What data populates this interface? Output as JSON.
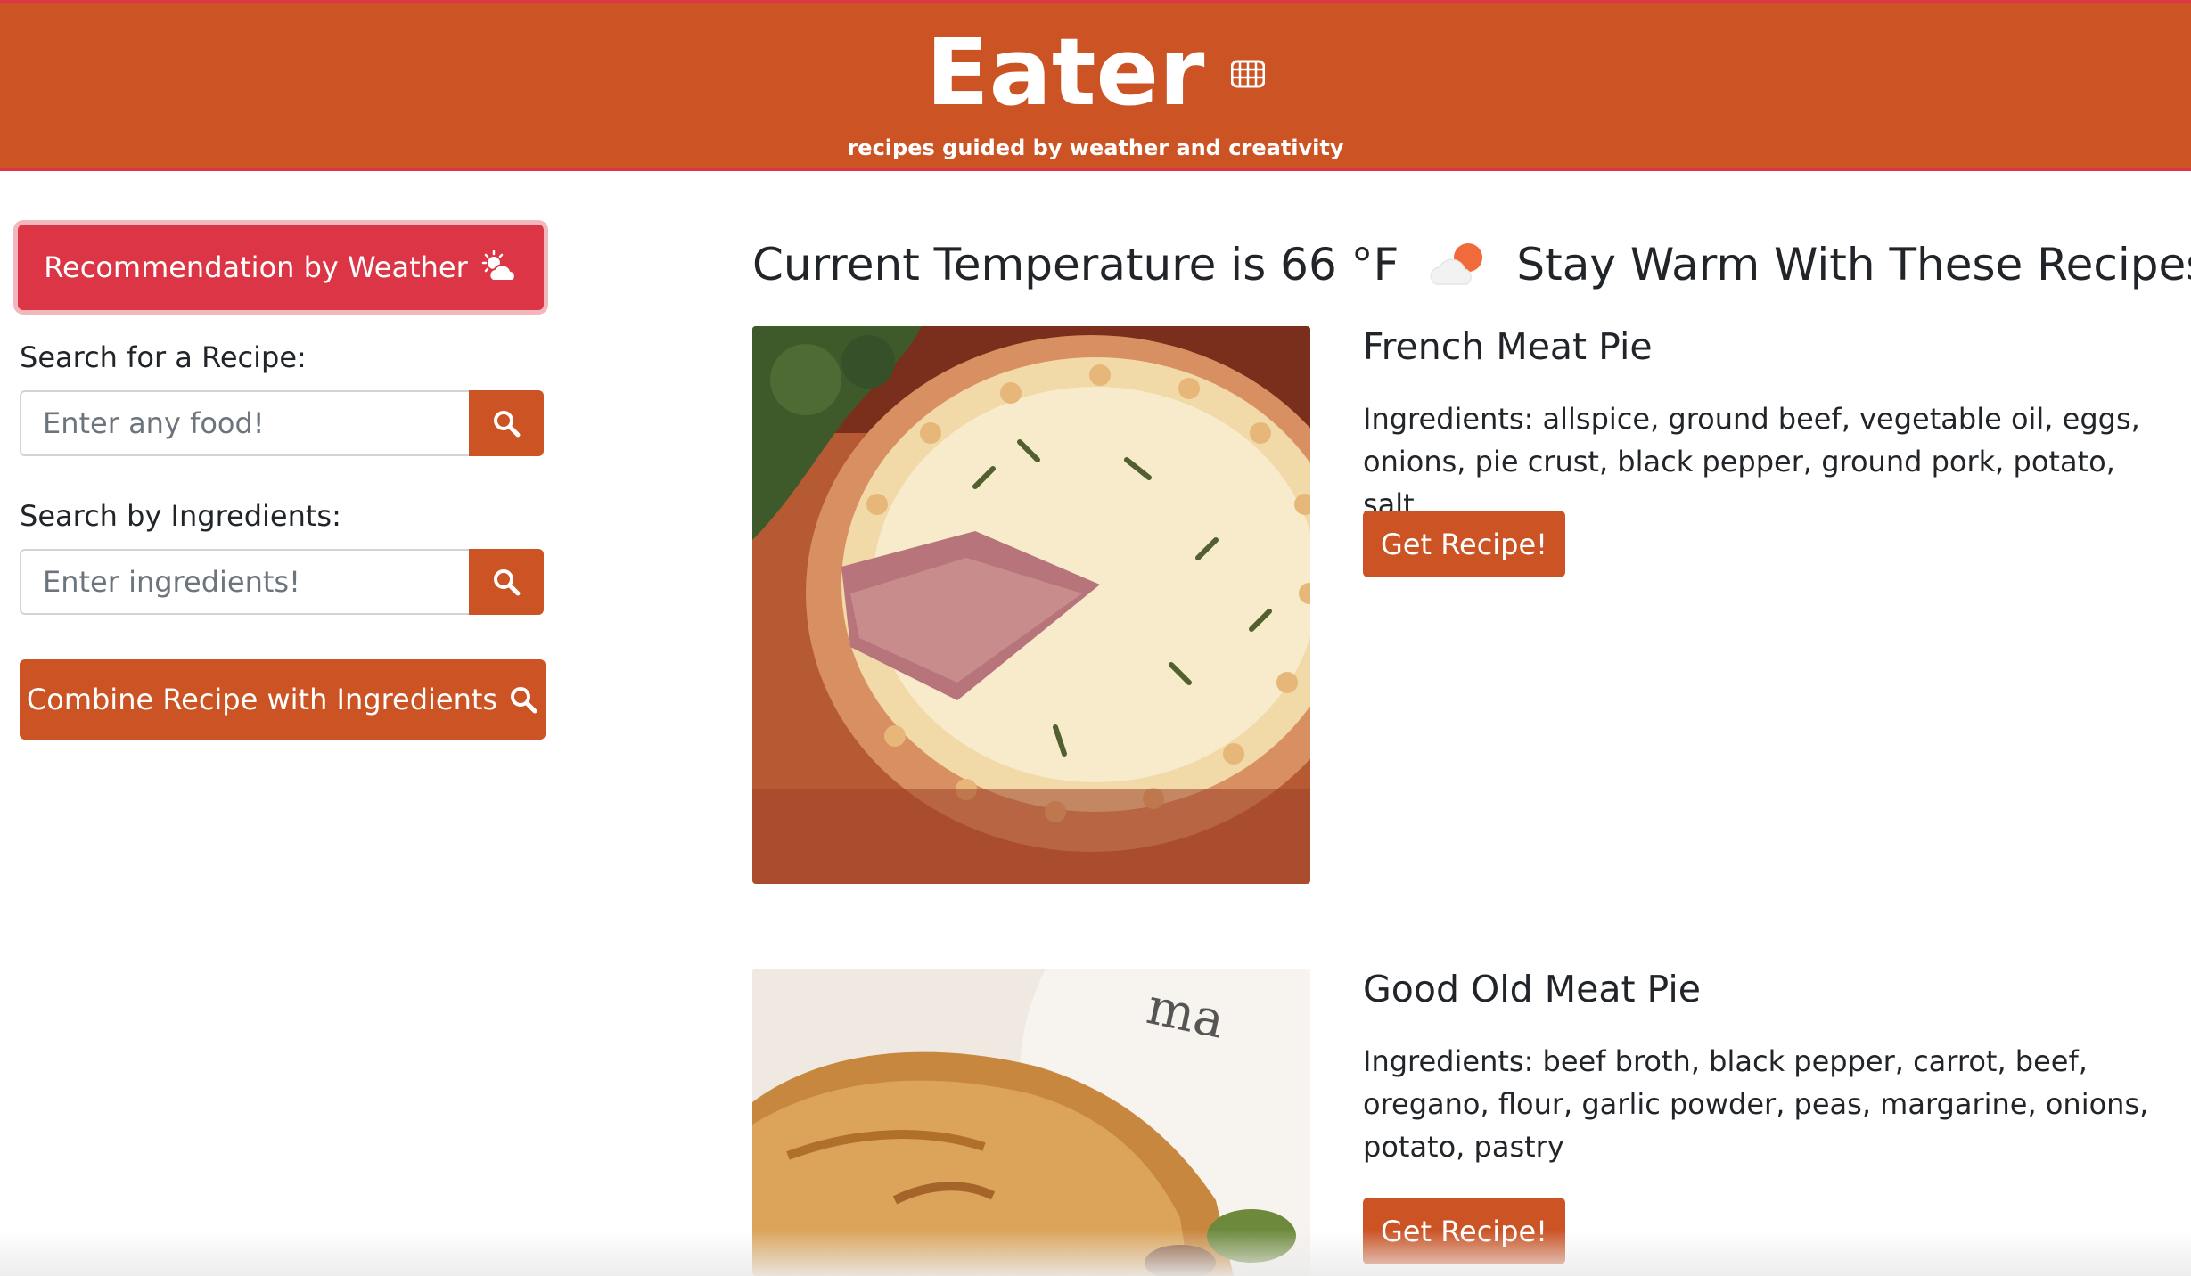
{
  "header": {
    "brand": "Eater",
    "brand_icon": "waffle-icon",
    "tagline": "recipes guided by weather and creativity"
  },
  "sidebar": {
    "weather_button_label": "Recommendation by Weather",
    "weather_button_icon": "cloud-sun-icon",
    "recipe_search": {
      "label": "Search for a Recipe:",
      "placeholder": "Enter any food!",
      "button_icon": "search-icon"
    },
    "ingredient_search": {
      "label": "Search by Ingredients:",
      "placeholder": "Enter ingredients!",
      "button_icon": "search-icon"
    },
    "combine_button_label": "Combine Recipe with Ingredients",
    "combine_button_icon": "search-icon"
  },
  "main": {
    "temperature_text": "Current Temperature is 66 °F",
    "weather_icon": "partly-cloudy-sun-icon",
    "recommendation_text": "Stay Warm With These Recipes:",
    "recipes": [
      {
        "title": "French Meat Pie",
        "ingredients": "Ingredients: allspice, ground beef, vegetable oil, eggs, onions, pie crust, black pepper, ground pork, potato, salt",
        "button_label": "Get Recipe!",
        "image_icon": "meat-pie-photo"
      },
      {
        "title": "Good Old Meat Pie",
        "ingredients": "Ingredients: beef broth, black pepper, carrot, beef, oregano, flour, garlic powder, peas, margarine, onions, potato, pastry",
        "button_label": "Get Recipe!",
        "image_icon": "meat-pie-photo"
      }
    ]
  },
  "colors": {
    "brand_orange": "#cb5324",
    "accent_red": "#dc3545",
    "text_dark": "#212529"
  }
}
